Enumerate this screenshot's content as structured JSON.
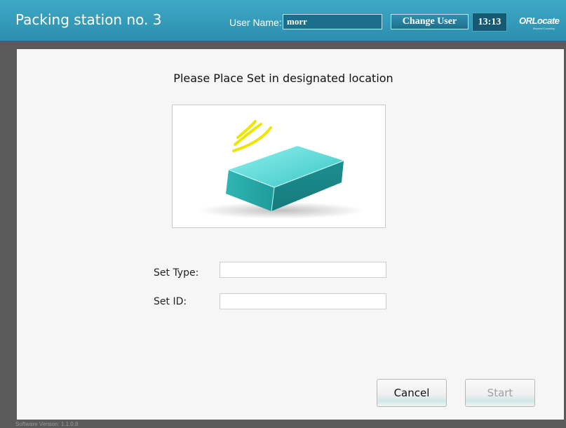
{
  "header": {
    "title": "Packing station no. 3",
    "user_label": "User Name:",
    "user_name": "morr",
    "change_user_label": "Change User",
    "time": "13:13",
    "logo_text": "ORLocate",
    "logo_tagline": "Beyond Counting"
  },
  "main": {
    "instruction": "Please Place Set in designated location",
    "illustration": "rfid-tray-icon",
    "fields": {
      "set_type_label": "Set Type:",
      "set_type_value": "",
      "set_id_label": "Set ID:",
      "set_id_value": ""
    },
    "buttons": {
      "cancel_label": "Cancel",
      "start_label": "Start",
      "start_enabled": false
    }
  },
  "footer": {
    "software_version": "Software Version: 1.1.0.8"
  },
  "colors": {
    "header_bg": "#2b8fae",
    "accent": "#36c0c0",
    "signal": "#f2e600"
  }
}
